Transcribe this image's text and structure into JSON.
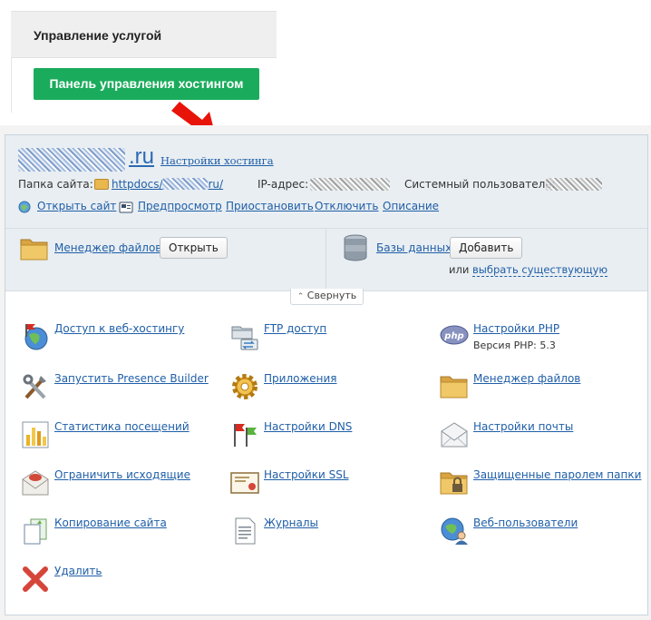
{
  "service": {
    "title": "Управление услугой",
    "panel_button": "Панель управления хостингом"
  },
  "domain": {
    "tld": ".ru",
    "settings_link": "Настройки хостинга"
  },
  "info": {
    "folder_label": "Папка сайта:",
    "folder_prefix": "httpdocs/",
    "folder_suffix": "ru/",
    "ip_label": "IP-адрес:",
    "sysuser_label": "Системный пользователь:"
  },
  "actions": [
    {
      "label": "Открыть сайт",
      "icon": "open-site-icon"
    },
    {
      "label": "Предпросмотр",
      "icon": "preview-icon"
    },
    {
      "label": "Приостановить"
    },
    {
      "label": "Отключить"
    },
    {
      "label": "Описание"
    }
  ],
  "tools": {
    "file_manager_label": "Менеджер файлов",
    "open_button": "Открыть",
    "databases_label": "Базы данных",
    "add_button": "Добавить",
    "or_text": "или",
    "select_existing": "выбрать существующую"
  },
  "collapse": {
    "label": "Свернуть",
    "icon": "chevron-up-icon"
  },
  "grid": {
    "col1": [
      {
        "label": "Доступ к веб-хостингу",
        "icon": "globe-flag-icon"
      },
      {
        "label": "Запустить Presence Builder",
        "icon": "tools-icon"
      },
      {
        "label": "Статистика посещений",
        "icon": "stats-icon"
      },
      {
        "label": "Ограничить исходящие",
        "icon": "mail-limit-icon"
      },
      {
        "label": "Копирование сайта",
        "icon": "copy-icon"
      },
      {
        "label": "Удалить",
        "icon": "delete-icon"
      }
    ],
    "col2": [
      {
        "label": "FTP доступ",
        "icon": "ftp-icon"
      },
      {
        "label": "Приложения",
        "icon": "gear-icon"
      },
      {
        "label": "Настройки DNS",
        "icon": "dns-flags-icon"
      },
      {
        "label": "Настройки SSL",
        "icon": "certificate-icon"
      },
      {
        "label": "Журналы",
        "icon": "log-icon"
      }
    ],
    "col3": [
      {
        "label": "Настройки PHP",
        "sub": "Версия PHP: 5.3",
        "icon": "php-icon"
      },
      {
        "label": "Менеджер файлов",
        "icon": "folder-icon"
      },
      {
        "label": "Настройки почты",
        "icon": "mail-icon"
      },
      {
        "label": "Защищенные паролем папки",
        "icon": "locked-folder-icon"
      },
      {
        "label": "Веб-пользователи",
        "icon": "web-users-icon"
      }
    ]
  },
  "colors": {
    "accent_green": "#1aac5c",
    "link_blue": "#1f5fa8",
    "arrow_red": "#e8140a"
  }
}
